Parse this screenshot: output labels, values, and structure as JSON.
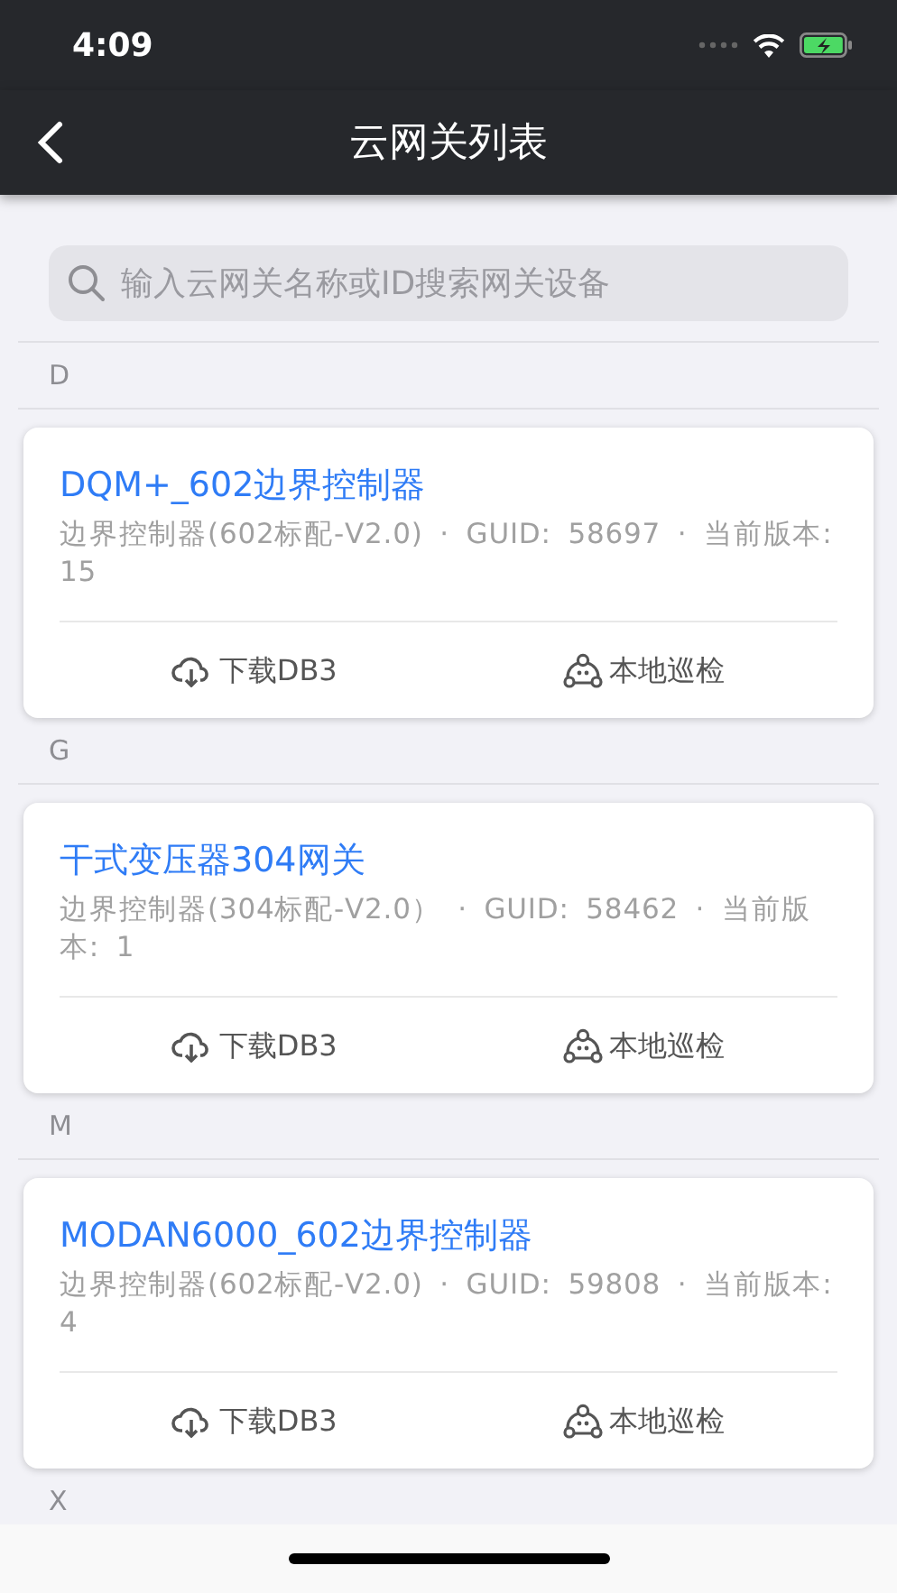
{
  "status_bar": {
    "time": "4:09"
  },
  "nav": {
    "title": "云网关列表"
  },
  "search": {
    "placeholder": "输入云网关名称或ID搜索网关设备"
  },
  "sections": [
    {
      "letter": "D",
      "gateways": [
        {
          "name": "DQM+_602边界控制器",
          "meta": "边界控制器(602标配-V2.0) · GUID: 58697 · 当前版本: 15",
          "actions": [
            {
              "kind": "download",
              "label": "下载DB3"
            },
            {
              "kind": "inspect",
              "label": "本地巡检"
            }
          ]
        }
      ]
    },
    {
      "letter": "G",
      "gateways": [
        {
          "name": "干式变压器304网关",
          "meta": "边界控制器(304标配-V2.0）  · GUID: 58462 · 当前版本: 1",
          "actions": [
            {
              "kind": "download",
              "label": "下载DB3"
            },
            {
              "kind": "inspect",
              "label": "本地巡检"
            }
          ]
        }
      ]
    },
    {
      "letter": "M",
      "gateways": [
        {
          "name": "MODAN6000_602边界控制器",
          "meta": "边界控制器(602标配-V2.0) · GUID: 59808 · 当前版本: 4",
          "actions": [
            {
              "kind": "download",
              "label": "下载DB3"
            },
            {
              "kind": "inspect",
              "label": "本地巡检"
            }
          ]
        }
      ]
    },
    {
      "letter": "X"
    }
  ]
}
